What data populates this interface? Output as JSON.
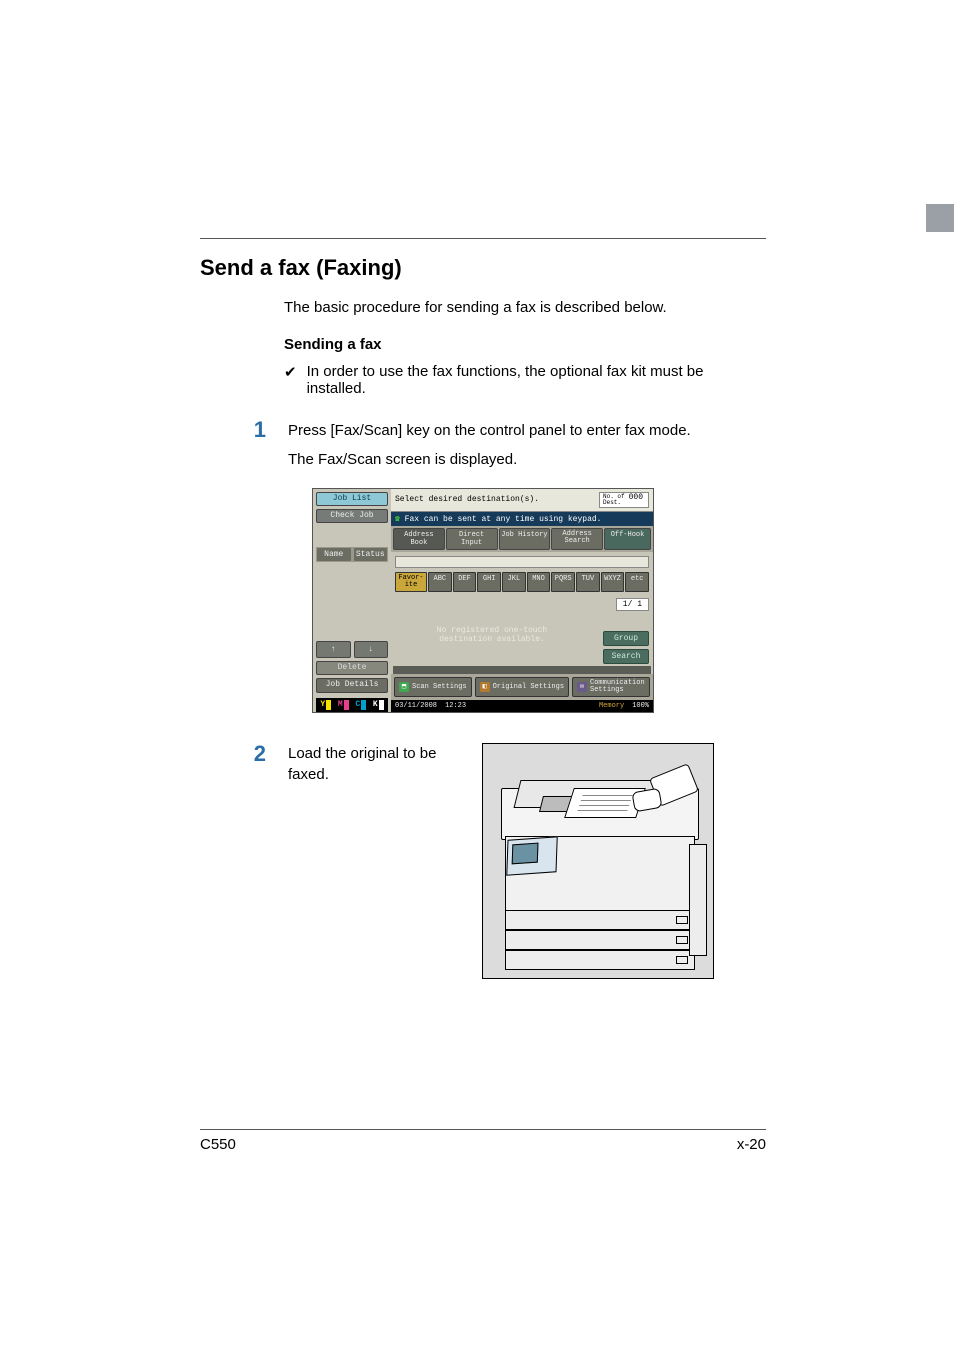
{
  "header": {},
  "section_title": "Send a fax (Faxing)",
  "intro": "The basic procedure for sending a fax is described below.",
  "sub_title": "Sending a fax",
  "prereq": "In order to use the fax functions, the optional fax kit must be installed.",
  "checkmark": "✔",
  "step1": {
    "num": "1",
    "line1": "Press [Fax/Scan] key on the control panel to enter fax mode.",
    "line2": "The Fax/Scan screen is displayed."
  },
  "step2": {
    "num": "2",
    "text": "Load the original to be faxed."
  },
  "screen": {
    "left": {
      "job_list": "Job List",
      "check_job": "Check Job",
      "name": "Name",
      "status": "Status",
      "arrow_up": "↑",
      "arrow_down": "↓",
      "delete": "Delete",
      "job_details": "Job Details",
      "toners": {
        "Y": "Y",
        "M": "M",
        "C": "C",
        "K": "K"
      }
    },
    "top_text": "Select desired destination(s).",
    "dest_label": "No. of\nDest.",
    "dest_count": "000",
    "sub_text": "Fax can be sent at any time using keypad.",
    "tabs": {
      "address_book": "Address Book",
      "direct_input": "Direct Input",
      "job_history": "Job History",
      "address_search": "Address\nSearch",
      "off_hook": "Off-Hook"
    },
    "alpha": {
      "first": "Favor-\nite",
      "keys": [
        "ABC",
        "DEF",
        "GHI",
        "JKL",
        "MNO",
        "PQRS",
        "TUV",
        "WXYZ",
        "etc"
      ]
    },
    "center_msg_l1": "No registered one-touch",
    "center_msg_l2": "destination available.",
    "page_indicator": "1/  1",
    "group": "Group",
    "search": "Search",
    "bottom": {
      "scan_settings": "Scan Settings",
      "original_settings": "Original Settings",
      "comm_settings": "Communication\nSettings"
    },
    "status_bar": {
      "date": "03/11/2008",
      "time": "12:23",
      "memory_lbl": "Memory",
      "memory_val": "100%"
    }
  },
  "footer": {
    "left": "C550",
    "right": "x-20"
  }
}
